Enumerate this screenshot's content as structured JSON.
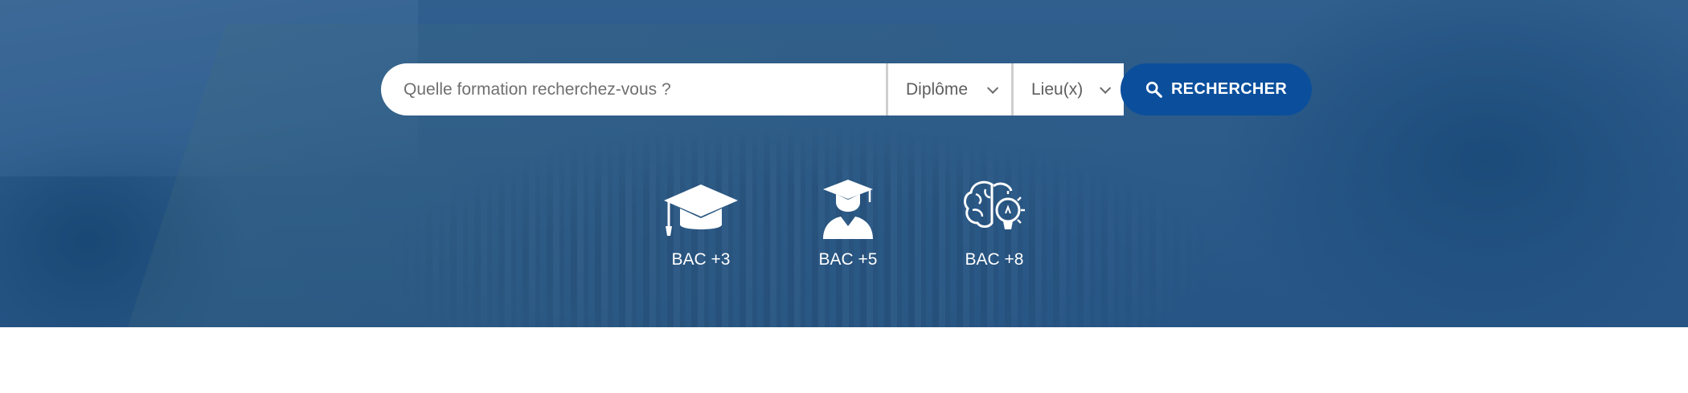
{
  "search": {
    "placeholder": "Quelle formation recherchez-vous ?",
    "diplome_label": "Diplôme",
    "lieu_label": "Lieu(x)",
    "button_label": "RECHERCHER"
  },
  "degrees": [
    {
      "label": "BAC +3",
      "icon": "graduation-cap-icon"
    },
    {
      "label": "BAC +5",
      "icon": "graduate-user-icon"
    },
    {
      "label": "BAC +8",
      "icon": "brain-lightbulb-icon"
    }
  ],
  "colors": {
    "button": "#0b4f9c",
    "hero_overlay": "#1f5a96",
    "text_light": "#ffffff"
  }
}
